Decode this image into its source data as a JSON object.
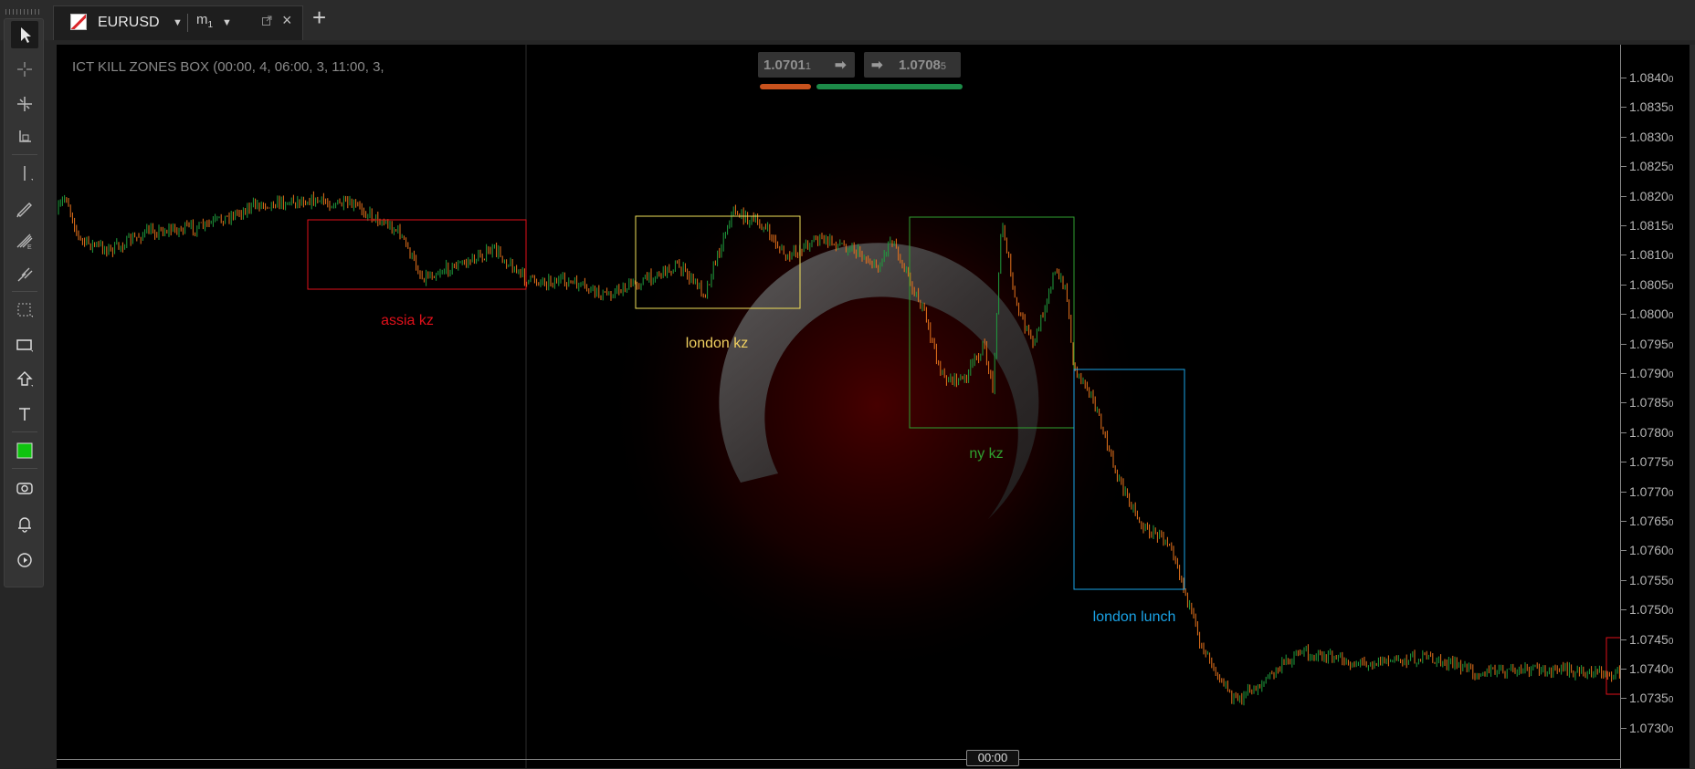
{
  "tab": {
    "symbol": "EURUSD",
    "timeframe": "m",
    "timeframe_sub": "1"
  },
  "indicator_label": "ICT KILL ZONES BOX (00:00, 4, 06:00, 3, 11:00, 3,",
  "quote": {
    "bid": "1.0701",
    "bid_small": "1",
    "ask": "1.0708",
    "ask_small": "5"
  },
  "zones": [
    {
      "label": "assia kz",
      "color": "#e0101a"
    },
    {
      "label": "london kz",
      "color": "#f0e05a"
    },
    {
      "label": "ny kz",
      "color": "#2fa02f"
    },
    {
      "label": "london lunch",
      "color": "#1aa3e6"
    }
  ],
  "price_axis": [
    {
      "main": "1.0840",
      "small": "0"
    },
    {
      "main": "1.0835",
      "small": "0"
    },
    {
      "main": "1.0830",
      "small": "0"
    },
    {
      "main": "1.0825",
      "small": "0"
    },
    {
      "main": "1.0820",
      "small": "0"
    },
    {
      "main": "1.0815",
      "small": "0"
    },
    {
      "main": "1.0810",
      "small": "0"
    },
    {
      "main": "1.0805",
      "small": "0"
    },
    {
      "main": "1.0800",
      "small": "0"
    },
    {
      "main": "1.0795",
      "small": "0"
    },
    {
      "main": "1.0790",
      "small": "0"
    },
    {
      "main": "1.0785",
      "small": "0"
    },
    {
      "main": "1.0780",
      "small": "0"
    },
    {
      "main": "1.0775",
      "small": "0"
    },
    {
      "main": "1.0770",
      "small": "0"
    },
    {
      "main": "1.0765",
      "small": "0"
    },
    {
      "main": "1.0760",
      "small": "0"
    },
    {
      "main": "1.0755",
      "small": "0"
    },
    {
      "main": "1.0750",
      "small": "0"
    },
    {
      "main": "1.0745",
      "small": "0"
    },
    {
      "main": "1.0740",
      "small": "0"
    },
    {
      "main": "1.0735",
      "small": "0"
    },
    {
      "main": "1.0730",
      "small": "0"
    }
  ],
  "crosshair_time": "00:00",
  "colors": {
    "bull": "#1f9e3e",
    "bear": "#e8731c",
    "background": "#000000"
  },
  "tools": [
    "cursor-icon",
    "crosshair-icon",
    "zoom-icon",
    "measure-icon",
    "line-icon",
    "pencil-icon",
    "fibonacci-icon",
    "pitchfork-icon",
    "pattern-icon",
    "rectangle-icon",
    "arrow-shape-icon",
    "text-icon",
    "color-swatch-icon",
    "camera-icon",
    "alert-bell-icon",
    "replay-icon"
  ]
}
